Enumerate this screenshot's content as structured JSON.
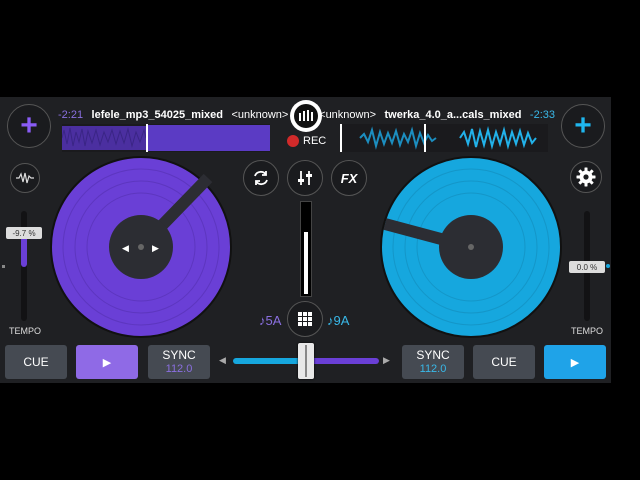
{
  "colors": {
    "deck_left": "#6a3fd6",
    "deck_right": "#16a7de",
    "rec": "#d12a2a",
    "panel": "#1f2023"
  },
  "deck_left": {
    "time": "-2:21",
    "title": "lefele_mp3_54025_mixed",
    "artist": "<unknown>",
    "key": "♪5A",
    "tempo_label": "TEMPO",
    "tempo_value": "-9.7 %",
    "cue_label": "CUE",
    "play_icon": "▶",
    "sync_label": "SYNC",
    "bpm": "112.0",
    "add_icon": "+",
    "waveform_icon": "waveform-icon"
  },
  "deck_right": {
    "time": "-2:33",
    "title": "twerka_4.0_a...cals_mixed",
    "artist": "<unknown>",
    "key": "♪9A",
    "tempo_label": "TEMPO",
    "tempo_value": "0.0 %",
    "cue_label": "CUE",
    "play_icon": "▶",
    "sync_label": "SYNC",
    "bpm": "112.0",
    "add_icon": "+",
    "settings_icon": "gear-icon"
  },
  "center": {
    "rec_label": "REC",
    "fx_label": "FX",
    "sync_loop_icon": "refresh-icon",
    "mixer_icon": "sliders-icon",
    "grid_icon": "grid-icon",
    "logo_icon": "app-logo-icon",
    "crossfader_left_arrow": "◀",
    "crossfader_right_arrow": "▶"
  }
}
